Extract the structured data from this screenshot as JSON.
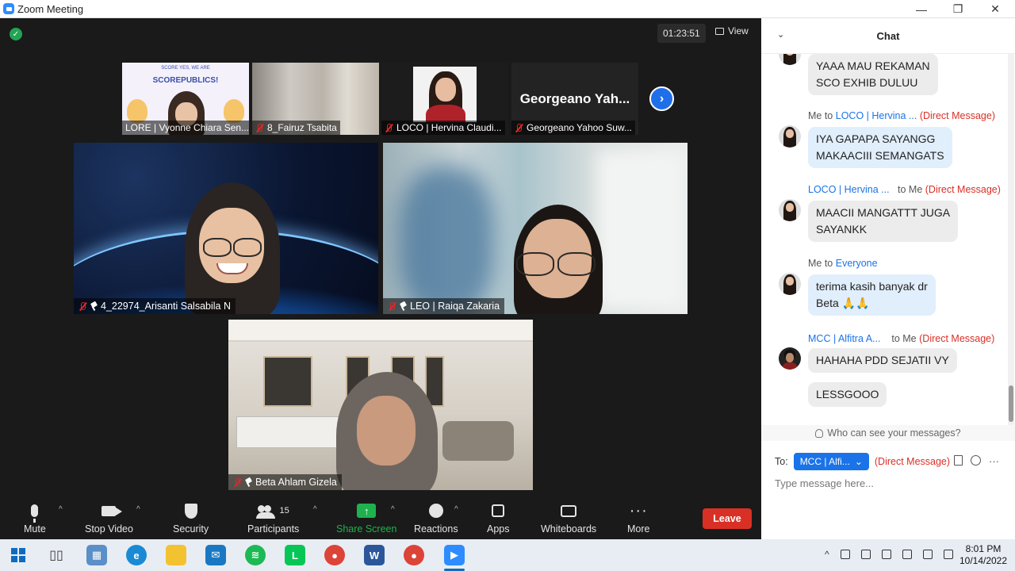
{
  "window": {
    "title": "Zoom Meeting",
    "minimize": "—",
    "restore": "❐",
    "close": "✕"
  },
  "meeting": {
    "timer": "01:23:51",
    "view_label": "View",
    "thumbnails": [
      {
        "name": "LORE | Vyonne Chiara Sen...",
        "logo": "SCOREPUBLICS!",
        "logo_small": "SCORE  YES, WE ARE"
      },
      {
        "name": "8_Fairuz Tsabita"
      },
      {
        "name": "LOCO | Hervina Claudi..."
      },
      {
        "name": "Georgeano Yahoo Suw...",
        "display": "Georgeano  Yah..."
      }
    ],
    "tiles": [
      {
        "name": "4_22974_Arisanti Salsabila N"
      },
      {
        "name": "LEO | Raiqa Zakaria"
      },
      {
        "name": "Beta Ahlam Gizela"
      }
    ]
  },
  "toolbar": {
    "mute": "Mute",
    "stop_video": "Stop Video",
    "security": "Security",
    "participants": "Participants",
    "participants_count": "15",
    "share_screen": "Share Screen",
    "reactions": "Reactions",
    "apps": "Apps",
    "whiteboards": "Whiteboards",
    "more": "More",
    "leave": "Leave",
    "caret": "^"
  },
  "chat": {
    "title": "Chat",
    "messages": [
      {
        "text1": "YAAA MAU REKAMAN",
        "text2": "SCO EXHIB DULUU"
      },
      {
        "sender": "Me to",
        "who": "LOCO | Hervina ...",
        "dm": "(Direct Message)",
        "text1": "IYA GAPAPA SAYANGG",
        "text2": "MAKAACIII SEMANGATS"
      },
      {
        "sender": "LOCO | Hervina ...",
        "to": "to Me",
        "dm": "(Direct Message)",
        "text1": "MAACII MANGATTT JUGA",
        "text2": "SAYANKK"
      },
      {
        "sender": "Me to",
        "who": "Everyone",
        "text1": "terima kasih banyak dr",
        "text2": "Beta 🙏🙏"
      },
      {
        "sender": "MCC | Alfitra A...",
        "to": "to Me",
        "dm": "(Direct Message)",
        "text1": "HAHAHA PDD SEJATII VY",
        "text2": "LESSGOOO"
      }
    ],
    "who_can_see": "Who can see your messages?",
    "to_label": "To:",
    "to_value": "MCC | Alfi...",
    "to_dm": "(Direct Message)",
    "input_placeholder": "Type message here...",
    "more_dots": "···"
  },
  "taskbar": {
    "time": "8:01 PM",
    "date": "10/14/2022"
  }
}
